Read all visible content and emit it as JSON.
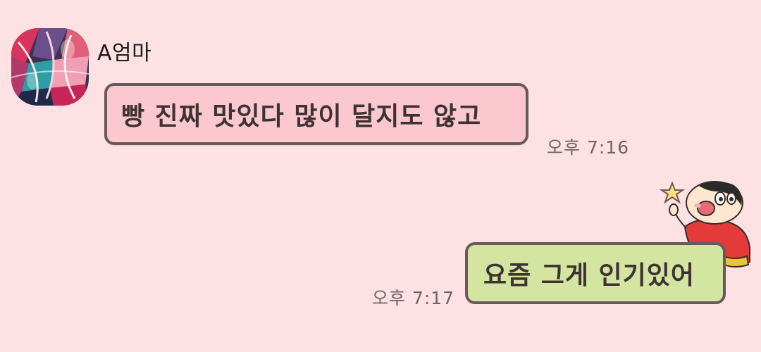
{
  "conversation": {
    "contact_name": "A엄마",
    "messages": [
      {
        "direction": "received",
        "text": "빵 진짜 맛있다 많이 달지도 않고",
        "time": "오후 7:16"
      },
      {
        "direction": "sent",
        "text": "요즘 그게 인기있어",
        "time": "오후 7:17"
      }
    ]
  },
  "icons": {
    "avatar": "abstract-avatar-image",
    "sticker": "cartoon-boy-sticker"
  },
  "colors": {
    "background": "#fde1e3",
    "received_bubble": "#fbc8cf",
    "sent_bubble": "#d3e5a1",
    "bubble_border": "#6a5959"
  }
}
